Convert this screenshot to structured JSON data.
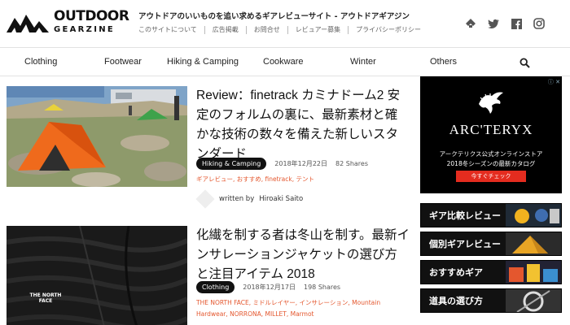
{
  "site": {
    "logo_line1": "OUTDOOR",
    "logo_line2": "GEARZINE",
    "tagline": "アウトドアのいいものを追い求めるギアレビューサイト - アウトドアギアジン",
    "subnav": [
      "このサイトについて",
      "広告掲載",
      "お問合せ",
      "レビュアー募集",
      "プライバシーポリシー"
    ]
  },
  "social_icons": [
    "feedly-icon",
    "twitter-icon",
    "facebook-icon",
    "instagram-icon"
  ],
  "nav": {
    "items": [
      "Clothing",
      "Footwear",
      "Hiking & Camping",
      "Cookware",
      "Winter",
      "Others"
    ],
    "search_icon": "search-icon"
  },
  "articles": [
    {
      "title": "Review：finetrack カミナドーム2 安定のフォルムの裏に、最新素材と確かな技術の数々を備えた新しいスタンダード",
      "category": "Hiking & Camping",
      "date": "2018年12月22日",
      "shares": "82 Shares",
      "tags": "ギアレビュー, おすすめ, finetrack, テント",
      "author_prefix": "written by",
      "author": "Hiroaki Saito"
    },
    {
      "title": "化繊を制する者は冬山を制す。最新インサレーションジャケットの選び方と注目アイテム 2018",
      "category": "Clothing",
      "date": "2018年12月17日",
      "shares": "198 Shares",
      "tags": "THE NORTH FACE, ミドルレイヤー, インサレーション, Mountain Hardwear, NORRONA, MILLET, Marmot",
      "jacket_logo": "THE NORTH FACE"
    }
  ],
  "sidebar": {
    "ad": {
      "brand": "ARC'TERYX",
      "line1": "アークテリクス公式オンラインストア",
      "line2": "2018冬シーズンの最新カタログ",
      "button": "今すぐチェック",
      "ad_tag": "ⓘ ✕"
    },
    "banners": [
      "ギア比較レビュー",
      "個別ギアレビュー",
      "おすすめギア",
      "道具の選び方"
    ]
  },
  "colors": {
    "accent_tag": "#e4572e",
    "ad_button": "#e42c1f",
    "banner_bg": "#111111"
  }
}
